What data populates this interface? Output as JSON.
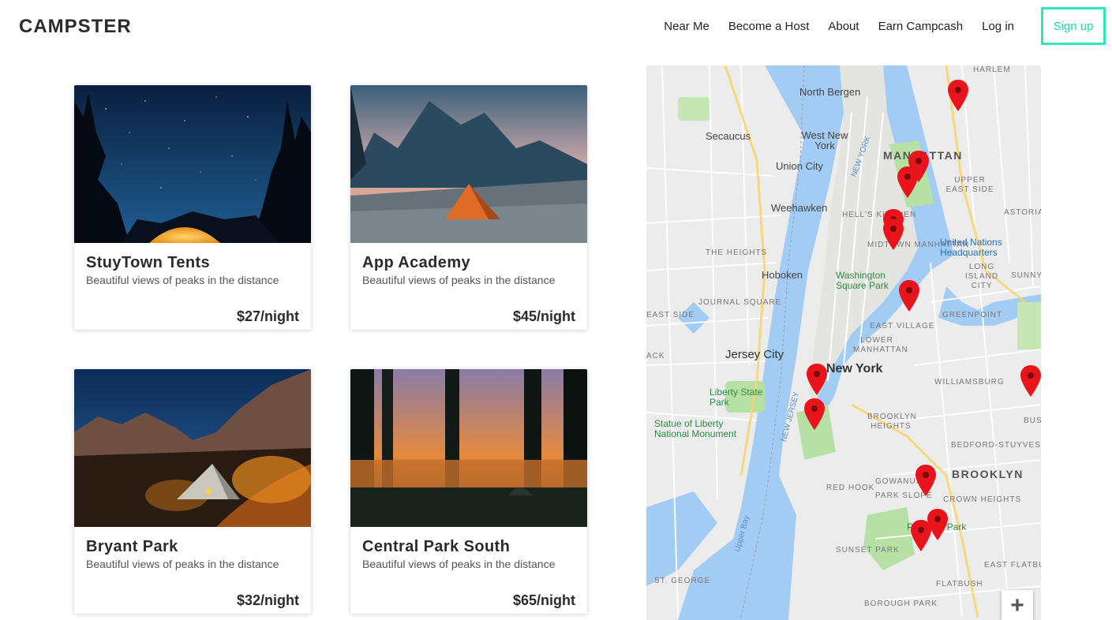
{
  "brand": {
    "name": "CAMPSTER"
  },
  "nav": {
    "links": [
      "Near Me",
      "Become a Host",
      "About",
      "Earn Campcash",
      "Log in"
    ],
    "signup_label": "Sign up",
    "accent_color": "#2ee6bd"
  },
  "listings": [
    {
      "title": "StuyTown Tents",
      "description": "Beautiful views of peaks in the distance",
      "price": "$27/night",
      "image": "night-sky-tent"
    },
    {
      "title": "App Academy",
      "description": "Beautiful views of peaks in the distance",
      "price": "$45/night",
      "image": "mountain-lake-tent"
    },
    {
      "title": "Bryant Park",
      "description": "Beautiful views of peaks in the distance",
      "price": "$32/night",
      "image": "desert-camp-fire"
    },
    {
      "title": "Central Park South",
      "description": "Beautiful views of peaks in the distance",
      "price": "$65/night",
      "image": "sunset-forest-lake"
    }
  ],
  "map": {
    "labels": {
      "manhattan": "MANHATTAN",
      "new_york": "New York",
      "brooklyn": "BROOKLYN",
      "jersey_city": "Jersey City",
      "hoboken": "Hoboken",
      "union_city": "Union City",
      "weehawken": "Weehawken",
      "secaucus": "Secaucus",
      "north_bergen": "North Bergen",
      "west_new_york": "West New York",
      "harlem": "HARLEM",
      "upper_east_side": "UPPER EAST SIDE",
      "hells_kitchen": "HELL'S KITCHEN",
      "midtown": "MIDTOWN MANHATTAN",
      "the_heights": "THE HEIGHTS",
      "journal_square": "JOURNAL SQUARE",
      "east_village": "EAST VILLAGE",
      "lower_manhattan": "LOWER MANHATTAN",
      "greenpoint": "GREENPOINT",
      "williamsburg": "WILLIAMSBURG",
      "long_island_city": "LONG ISLAND CITY",
      "brooklyn_heights": "BROOKLYN HEIGHTS",
      "bedford_stuyvesant": "BEDFORD-STUYVESANT",
      "gowanus": "GOWANUS",
      "park_slope": "PARK SLOPE",
      "red_hook": "RED HOOK",
      "crown_heights": "CROWN HEIGHTS",
      "sunset_park": "SUNSET PARK",
      "east_flatbush": "EAST FLATBUSH",
      "flatbush": "FLATBUSH",
      "borough_park": "BOROUGH PARK",
      "st_george": "ST. GEORGE",
      "astoria": "ASTORIA",
      "sunny": "SUNNY",
      "bus": "BUS",
      "east_side": "EAST SIDE",
      "ack": "ACK",
      "liberty_state_park": "Liberty State Park",
      "washington_square_park": "Washington Square Park",
      "statue_of_liberty": "Statue of Liberty National Monument",
      "united_nations": "United Nations Headquarters",
      "prospect_park": "Prospect Park",
      "upper_bay": "Upper Bay",
      "new_jersey": "NEW JERSEY",
      "new_york_state": "NEW YORK"
    },
    "zoom_label": "+"
  }
}
